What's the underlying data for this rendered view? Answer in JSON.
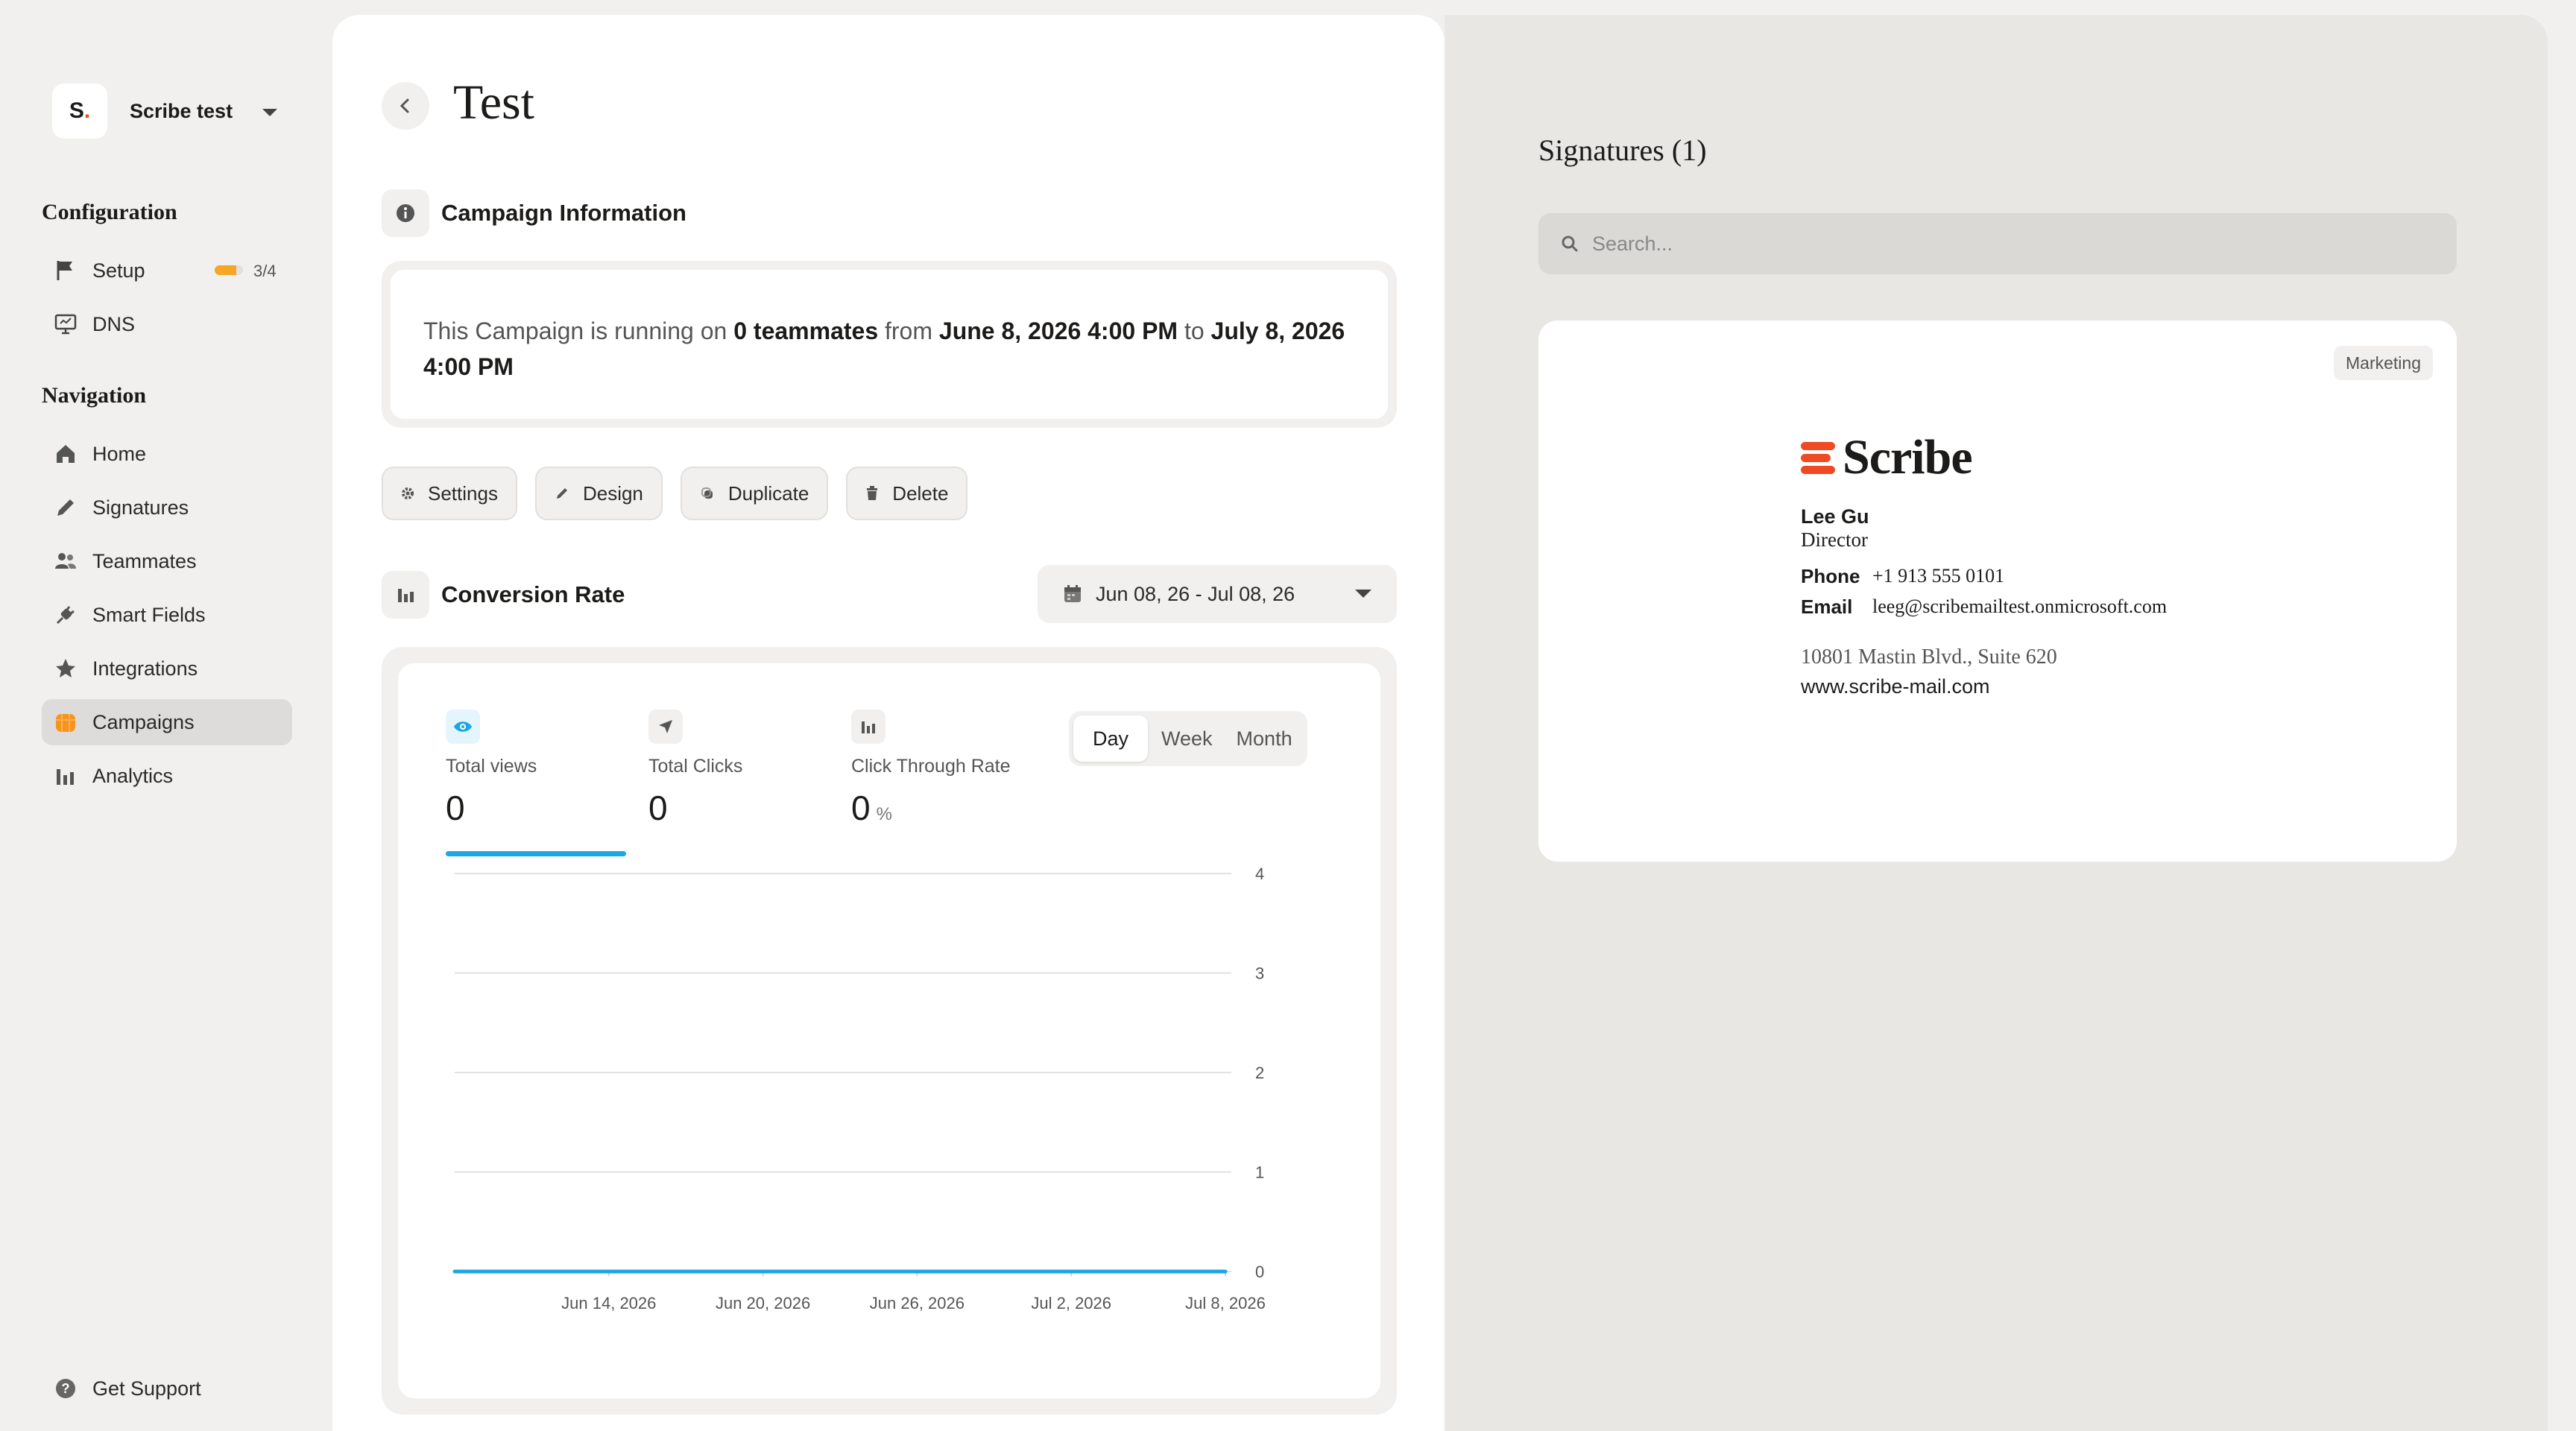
{
  "workspace": {
    "logo_letter": "S",
    "logo_dot": ".",
    "name": "Scribe test"
  },
  "sidebar": {
    "configuration_title": "Configuration",
    "config_items": [
      {
        "label": "Setup",
        "icon": "flag-icon",
        "progress_text": "3/4",
        "progress": 0.75
      },
      {
        "label": "DNS",
        "icon": "monitor-icon"
      }
    ],
    "navigation_title": "Navigation",
    "nav_items": [
      {
        "label": "Home",
        "icon": "home-icon"
      },
      {
        "label": "Signatures",
        "icon": "pencil-icon"
      },
      {
        "label": "Teammates",
        "icon": "users-icon"
      },
      {
        "label": "Smart Fields",
        "icon": "plug-icon"
      },
      {
        "label": "Integrations",
        "icon": "star-icon"
      },
      {
        "label": "Campaigns",
        "icon": "campaign-icon",
        "active": true
      },
      {
        "label": "Analytics",
        "icon": "bar-chart-icon"
      }
    ],
    "support_label": "Get Support"
  },
  "main": {
    "title": "Test",
    "campaign_info_title": "Campaign Information",
    "info": {
      "prefix": "This Campaign is running on ",
      "teammates": "0 teammates",
      "from_word": " from ",
      "start": "June 8, 2026 4:00 PM",
      "to_word": " to ",
      "end": "July 8, 2026 4:00 PM"
    },
    "actions": {
      "settings": "Settings",
      "design": "Design",
      "duplicate": "Duplicate",
      "delete": "Delete"
    },
    "conversion_title": "Conversion Rate",
    "date_range": "Jun 08, 26 - Jul 08, 26",
    "metrics": {
      "views_label": "Total views",
      "views_value": "0",
      "clicks_label": "Total Clicks",
      "clicks_value": "0",
      "ctr_label": "Click Through Rate",
      "ctr_value": "0",
      "ctr_unit": "%"
    },
    "granularity": {
      "day": "Day",
      "week": "Week",
      "month": "Month",
      "selected": "Day"
    }
  },
  "chart_data": {
    "type": "line",
    "x": [
      "Jun 8, 2026",
      "Jun 14, 2026",
      "Jun 20, 2026",
      "Jun 26, 2026",
      "Jul 2, 2026",
      "Jul 8, 2026"
    ],
    "xticks": [
      "Jun 14, 2026",
      "Jun 20, 2026",
      "Jun 26, 2026",
      "Jul 2, 2026",
      "Jul 8, 2026"
    ],
    "series": [
      {
        "values": [
          0,
          0,
          0,
          0,
          0,
          0
        ]
      }
    ],
    "yticks": [
      0,
      1,
      2,
      3,
      4
    ],
    "ylim": [
      0,
      4
    ],
    "grid": true,
    "line_color": "#1aa7e6"
  },
  "right": {
    "title": "Signatures (1)",
    "search_placeholder": "Search...",
    "card": {
      "badge": "Marketing",
      "brand": "Scribe",
      "name": "Lee Gu",
      "role": "Director",
      "phone_label": "Phone",
      "phone": "+1 913 555 0101",
      "email_label": "Email",
      "email": "leeg@scribemailtest.onmicrosoft.com",
      "address": "10801 Mastin Blvd., Suite 620",
      "website": "www.scribe-mail.com"
    }
  },
  "colors": {
    "accent": "#1aa7e6",
    "brand": "#f04a24",
    "progress": "#f5a623"
  }
}
